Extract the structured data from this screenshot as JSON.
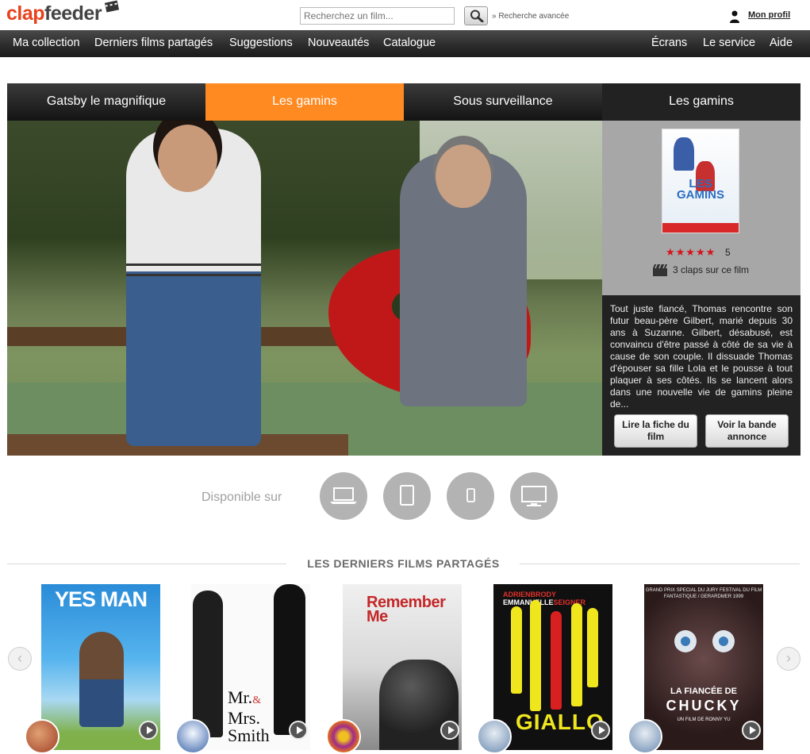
{
  "header": {
    "logo_part1": "clap",
    "logo_part2": "feeder",
    "search_placeholder": "Recherchez un film...",
    "advanced_search": "» Recherche avancée",
    "profile": "Mon profil"
  },
  "nav": {
    "left": [
      "Ma collection",
      "Derniers films partagés",
      "Suggestions",
      "Nouveautés",
      "Catalogue"
    ],
    "right": [
      "Écrans",
      "Le service",
      "Aide"
    ]
  },
  "featured": {
    "tabs": [
      "Gatsby le magnifique",
      "Les gamins",
      "Sous surveillance"
    ],
    "active_tab": 1,
    "side_title": "Les gamins",
    "poster_title": "LES GAMINS",
    "stars": "★★★★★",
    "rating": "5",
    "claps": "3 claps sur ce film",
    "synopsis": "Tout juste fiancé, Thomas rencontre son futur beau-père Gilbert, marié depuis 30 ans à Suzanne. Gilbert, désabusé, est convaincu d'être passé à côté de sa vie à cause de son couple. Il dissuade Thomas d'épouser sa fille Lola et le pousse à tout plaquer à ses côtés. Ils se lancent alors dans une nouvelle vie de gamins pleine de...",
    "btn_fiche": "Lire la fiche du film",
    "btn_bande": "Voir la bande annonce"
  },
  "available": {
    "label": "Disponible sur",
    "devices": [
      "laptop-icon",
      "tablet-icon",
      "phone-icon",
      "tv-icon"
    ]
  },
  "latest": {
    "title": "LES DERNIERS FILMS PARTAGÉS",
    "films": [
      {
        "title": "YES MAN"
      },
      {
        "title_line1": "Mr.",
        "amp": "&",
        "title_line2": "Mrs.",
        "title_line3": "Smith"
      },
      {
        "title_line1": "Remember",
        "title_line2": "Me"
      },
      {
        "cast_a": "ADRIEN",
        "cast_b": "BRODY",
        "cast_c": "EMMANUELLE",
        "cast_d": "SEIGNER",
        "title": "GIALLO"
      },
      {
        "header": "GRAND PRIX SPECIAL DU JURY FESTIVAL DU FILM FANTASTIQUE / GERARDMER 1999",
        "title_line1": "LA FIANCÉE DE",
        "title_line2": "CHUCKY",
        "director": "UN FILM DE RONNY YU"
      }
    ]
  },
  "colors": {
    "accent": "#ff8a22",
    "logo_red": "#e8401c",
    "nav_bg": "#2a2a2a",
    "star_red": "#d3141c"
  }
}
